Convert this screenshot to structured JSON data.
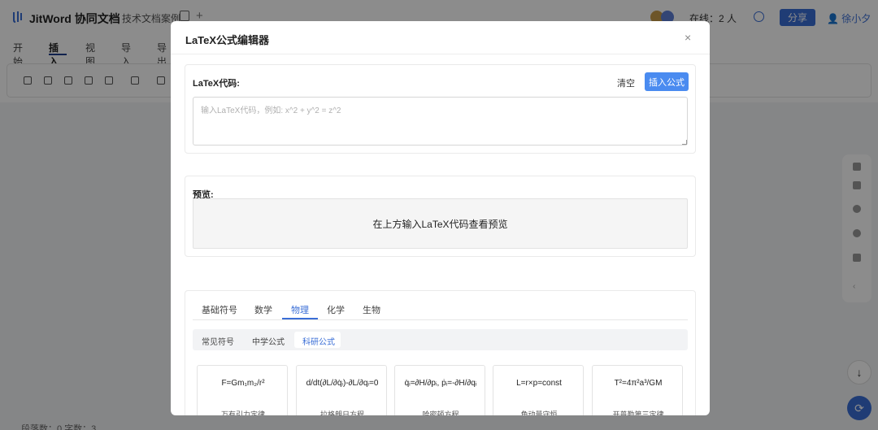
{
  "app": {
    "title": "JitWord 协同文档",
    "doc_name": "技术文档案例",
    "online": "在线：2 人",
    "share_label": "分享",
    "user_name": "徐小夕"
  },
  "menu": {
    "items": [
      {
        "label": "开始"
      },
      {
        "label": "插入"
      },
      {
        "label": "视图"
      },
      {
        "label": "导入"
      },
      {
        "label": "导出"
      }
    ]
  },
  "statusbar": {
    "text": "段落数：0   字数：3"
  },
  "modal": {
    "title": "LaTeX公式编辑器",
    "code_label": "LaTeX代码:",
    "clear_label": "清空",
    "insert_label": "插入公式",
    "input_placeholder": "输入LaTeX代码，例如: x^2 + y^2 = z^2",
    "input_value": "",
    "preview_label": "预览:",
    "preview_text": "在上方输入LaTeX代码查看预览",
    "categories": [
      {
        "label": "基础符号"
      },
      {
        "label": "数学"
      },
      {
        "label": "物理"
      },
      {
        "label": "化学"
      },
      {
        "label": "生物"
      }
    ],
    "active_category": "物理",
    "subcategories": [
      {
        "label": "常见符号"
      },
      {
        "label": "中学公式"
      },
      {
        "label": "科研公式"
      }
    ],
    "active_subcategory": "科研公式",
    "formulas": [
      {
        "formula": "F=Gm₁m₂/r²",
        "label": "万有引力定律"
      },
      {
        "formula": "d/dt(∂L/∂q̇ᵢ)-∂L/∂qᵢ=0",
        "label": "拉格朗日方程"
      },
      {
        "formula": "q̇ᵢ=∂H/∂pᵢ, ṗᵢ=-∂H/∂qᵢ",
        "label": "哈密顿方程"
      },
      {
        "formula": "L=r×p=const",
        "label": "角动量守恒"
      },
      {
        "formula": "T²=4π²a³/GM",
        "label": "开普勒第三定律"
      }
    ]
  },
  "colors": {
    "accent": "#3a6ed6",
    "insert_button": "#4a8bf0"
  }
}
